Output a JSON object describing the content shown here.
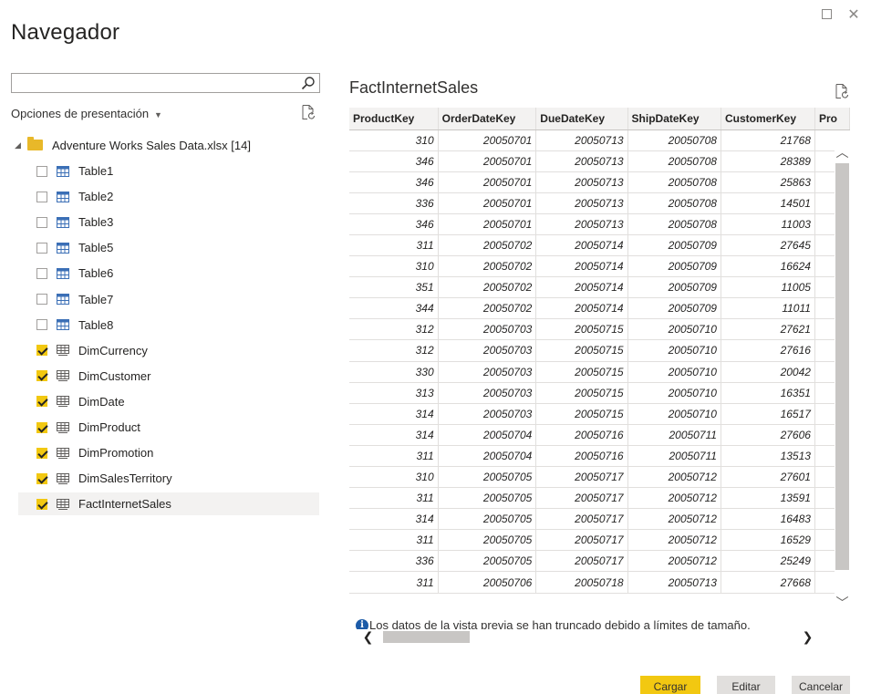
{
  "window": {
    "title": "Navegador"
  },
  "search": {
    "placeholder": "",
    "value": ""
  },
  "display_options": {
    "label": "Opciones de presentación"
  },
  "tree": {
    "root": {
      "label": "Adventure Works Sales Data.xlsx [14]",
      "expanded": true
    },
    "items": [
      {
        "label": "Table1",
        "checked": false,
        "icon": "table-icon"
      },
      {
        "label": "Table2",
        "checked": false,
        "icon": "table-icon"
      },
      {
        "label": "Table3",
        "checked": false,
        "icon": "table-icon"
      },
      {
        "label": "Table5",
        "checked": false,
        "icon": "table-icon"
      },
      {
        "label": "Table6",
        "checked": false,
        "icon": "table-icon"
      },
      {
        "label": "Table7",
        "checked": false,
        "icon": "table-icon"
      },
      {
        "label": "Table8",
        "checked": false,
        "icon": "table-icon"
      },
      {
        "label": "DimCurrency",
        "checked": true,
        "icon": "sheet-icon"
      },
      {
        "label": "DimCustomer",
        "checked": true,
        "icon": "sheet-icon"
      },
      {
        "label": "DimDate",
        "checked": true,
        "icon": "sheet-icon"
      },
      {
        "label": "DimProduct",
        "checked": true,
        "icon": "sheet-icon"
      },
      {
        "label": "DimPromotion",
        "checked": true,
        "icon": "sheet-icon"
      },
      {
        "label": "DimSalesTerritory",
        "checked": true,
        "icon": "sheet-icon"
      },
      {
        "label": "FactInternetSales",
        "checked": true,
        "icon": "sheet-icon",
        "selected": true
      }
    ]
  },
  "preview": {
    "title": "FactInternetSales",
    "columns": [
      "ProductKey",
      "OrderDateKey",
      "DueDateKey",
      "ShipDateKey",
      "CustomerKey",
      "Pro"
    ],
    "rows": [
      [
        "310",
        "20050701",
        "20050713",
        "20050708",
        "21768"
      ],
      [
        "346",
        "20050701",
        "20050713",
        "20050708",
        "28389"
      ],
      [
        "346",
        "20050701",
        "20050713",
        "20050708",
        "25863"
      ],
      [
        "336",
        "20050701",
        "20050713",
        "20050708",
        "14501"
      ],
      [
        "346",
        "20050701",
        "20050713",
        "20050708",
        "11003"
      ],
      [
        "311",
        "20050702",
        "20050714",
        "20050709",
        "27645"
      ],
      [
        "310",
        "20050702",
        "20050714",
        "20050709",
        "16624"
      ],
      [
        "351",
        "20050702",
        "20050714",
        "20050709",
        "11005"
      ],
      [
        "344",
        "20050702",
        "20050714",
        "20050709",
        "11011"
      ],
      [
        "312",
        "20050703",
        "20050715",
        "20050710",
        "27621"
      ],
      [
        "312",
        "20050703",
        "20050715",
        "20050710",
        "27616"
      ],
      [
        "330",
        "20050703",
        "20050715",
        "20050710",
        "20042"
      ],
      [
        "313",
        "20050703",
        "20050715",
        "20050710",
        "16351"
      ],
      [
        "314",
        "20050703",
        "20050715",
        "20050710",
        "16517"
      ],
      [
        "314",
        "20050704",
        "20050716",
        "20050711",
        "27606"
      ],
      [
        "311",
        "20050704",
        "20050716",
        "20050711",
        "13513"
      ],
      [
        "310",
        "20050705",
        "20050717",
        "20050712",
        "27601"
      ],
      [
        "311",
        "20050705",
        "20050717",
        "20050712",
        "13591"
      ],
      [
        "314",
        "20050705",
        "20050717",
        "20050712",
        "16483"
      ],
      [
        "311",
        "20050705",
        "20050717",
        "20050712",
        "16529"
      ],
      [
        "336",
        "20050705",
        "20050717",
        "20050712",
        "25249"
      ],
      [
        "311",
        "20050706",
        "20050718",
        "20050713",
        "27668"
      ]
    ],
    "truncation_note": "Los datos de la vista previa se han truncado debido a límites de tamaño."
  },
  "buttons": {
    "load": "Cargar",
    "edit": "Editar",
    "cancel": "Cancelar"
  },
  "colors": {
    "accent": "#f2c811",
    "info": "#1c5ba8",
    "selected_bg": "#f3f2f1"
  }
}
